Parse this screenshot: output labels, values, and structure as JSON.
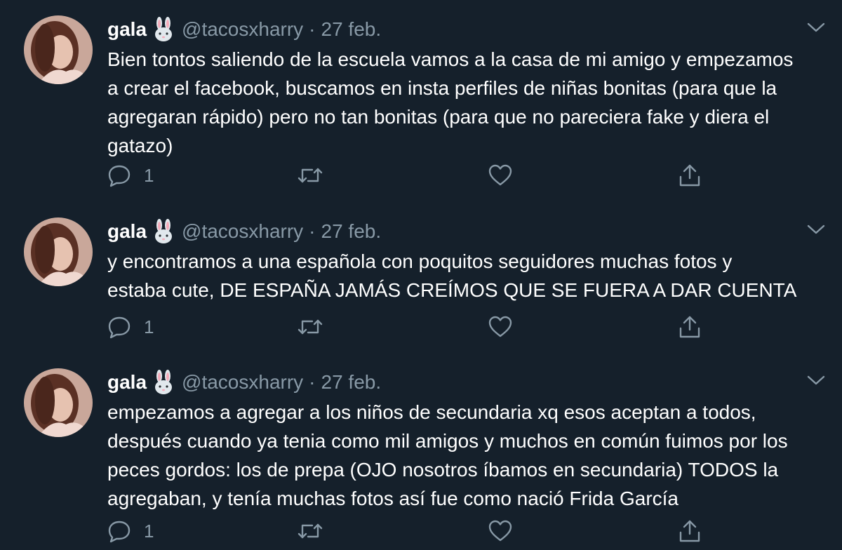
{
  "tweets": [
    {
      "name": "gala",
      "handle": "@tacosxharry",
      "separator": "·",
      "date": "27 feb.",
      "lines": [
        "Bien tontos saliendo de la escuela vamos a la casa de mi amigo y empezamos",
        "a crear el facebook, buscamos en insta perfiles de niñas bonitas (para que la",
        "agregaran rápido) pero no tan bonitas (para que no pareciera fake y diera el",
        "gatazo)"
      ],
      "reply_count": "1"
    },
    {
      "name": "gala",
      "handle": "@tacosxharry",
      "separator": "·",
      "date": "27 feb.",
      "lines": [
        "y encontramos a una española con poquitos seguidores muchas fotos y",
        "estaba cute, DE ESPAÑA JAMÁS CREÍMOS QUE SE FUERA A DAR CUENTA"
      ],
      "reply_count": "1"
    },
    {
      "name": "gala",
      "handle": "@tacosxharry",
      "separator": "·",
      "date": "27 feb.",
      "lines": [
        "empezamos a agregar a los niños de secundaria xq esos aceptan a todos,",
        "después cuando ya tenia como mil amigos y muchos en común fuimos por los",
        "peces gordos: los de prepa (OJO nosotros íbamos en secundaria) TODOS la",
        "agregaban, y tenía muchas fotos así fue como nació Frida García"
      ],
      "reply_count": "1"
    }
  ],
  "icons": {
    "name_emoji": "rabbit-face-icon",
    "reply": "reply-icon",
    "retweet": "retweet-icon",
    "like": "heart-icon",
    "share": "share-icon",
    "menu": "chevron-down-icon"
  },
  "colors": {
    "background": "#15202b",
    "primary_text": "#ffffff",
    "secondary_text": "#8899a6"
  }
}
